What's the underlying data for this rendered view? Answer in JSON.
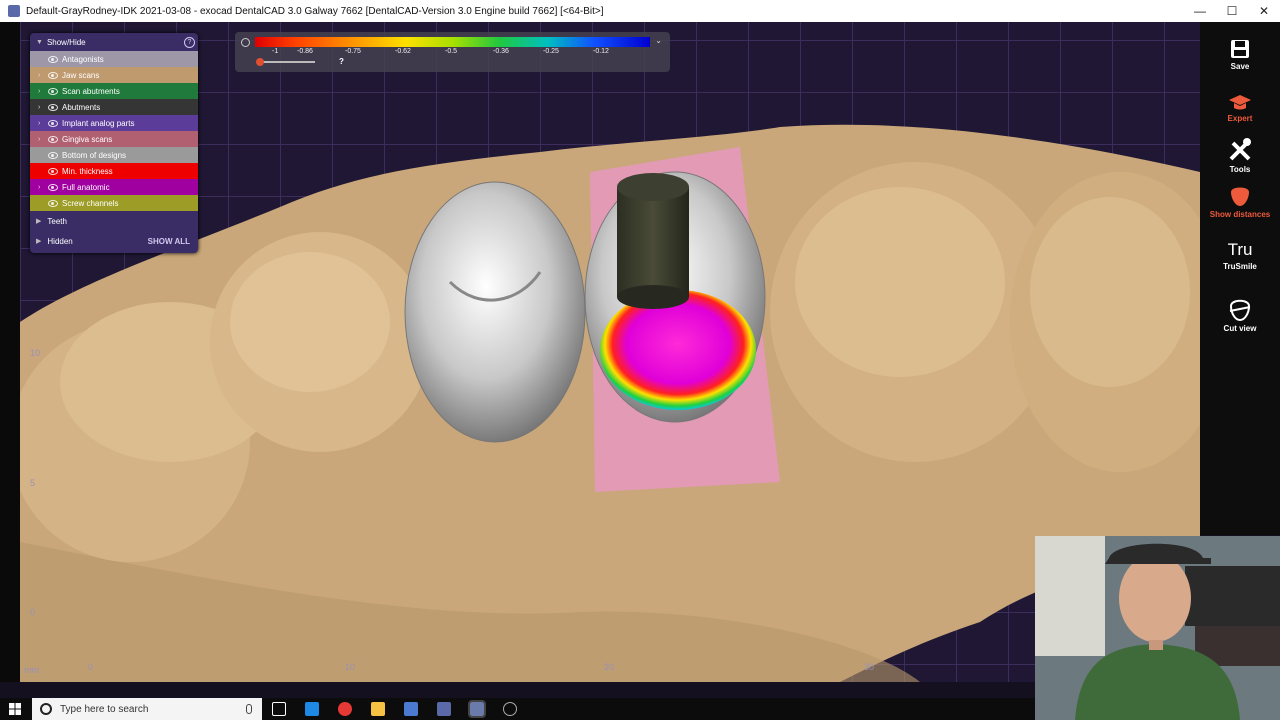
{
  "window": {
    "title": "Default-GrayRodney-IDK 2021-03-08 - exocad DentalCAD 3.0 Galway 7662 [DentalCAD-Version 3.0 Engine build 7662] [<64-Bit>]",
    "minimize": "—",
    "maximize": "☐",
    "close": "✕"
  },
  "panel": {
    "header": "Show/Hide",
    "items": [
      {
        "label": "Antagonists",
        "color": "#9d97a8",
        "expandable": false
      },
      {
        "label": "Jaw scans",
        "color": "#bf9a6e",
        "expandable": true
      },
      {
        "label": "Scan abutments",
        "color": "#1f7a3b",
        "expandable": true
      },
      {
        "label": "Abutments",
        "color": "#353535",
        "expandable": true
      },
      {
        "label": "Implant analog parts",
        "color": "#5b3c98",
        "expandable": true
      },
      {
        "label": "Gingiva scans",
        "color": "#b06070",
        "expandable": true
      },
      {
        "label": "Bottom of designs",
        "color": "#9a9a9a",
        "expandable": false
      },
      {
        "label": "Min. thickness",
        "color": "#ee0000",
        "expandable": false
      },
      {
        "label": "Full anatomic",
        "color": "#a000a0",
        "expandable": true
      },
      {
        "label": "Screw channels",
        "color": "#9c9c26",
        "expandable": false
      }
    ],
    "teeth": "Teeth",
    "hidden": "Hidden",
    "show_all": "SHOW ALL"
  },
  "scale": {
    "ticks": [
      "-1",
      "-0.86",
      "-0.75",
      "-0.62",
      "-0.5",
      "-0.36",
      "-0.25",
      "-0.12"
    ],
    "slider_label": "?"
  },
  "axes": {
    "y": [
      "10",
      "5",
      "0"
    ],
    "x": [
      "mm",
      "0",
      "10",
      "20",
      "30"
    ]
  },
  "toolbar": {
    "items": [
      {
        "label": "Save",
        "color": "#ffffff"
      },
      {
        "label": "Expert",
        "color": "#ee5a3c"
      },
      {
        "label": "Tools",
        "color": "#ffffff"
      },
      {
        "label": "Show distances",
        "color": "#ee5a3c"
      },
      {
        "label": "TruSmile",
        "color": "#ffffff",
        "icon_text": "Tru"
      },
      {
        "label": "Cut view",
        "color": "#ffffff"
      }
    ]
  },
  "taskbar": {
    "search_placeholder": "Type here to search"
  }
}
